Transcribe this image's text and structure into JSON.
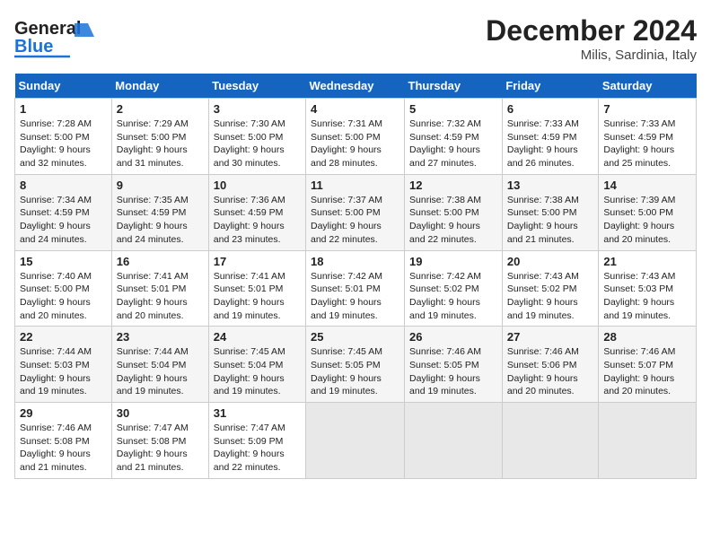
{
  "header": {
    "logo_general": "General",
    "logo_blue": "Blue",
    "month_title": "December 2024",
    "location": "Milis, Sardinia, Italy"
  },
  "weekdays": [
    "Sunday",
    "Monday",
    "Tuesday",
    "Wednesday",
    "Thursday",
    "Friday",
    "Saturday"
  ],
  "weeks": [
    [
      {
        "day": "1",
        "sunrise": "Sunrise: 7:28 AM",
        "sunset": "Sunset: 5:00 PM",
        "daylight": "Daylight: 9 hours and 32 minutes."
      },
      {
        "day": "2",
        "sunrise": "Sunrise: 7:29 AM",
        "sunset": "Sunset: 5:00 PM",
        "daylight": "Daylight: 9 hours and 31 minutes."
      },
      {
        "day": "3",
        "sunrise": "Sunrise: 7:30 AM",
        "sunset": "Sunset: 5:00 PM",
        "daylight": "Daylight: 9 hours and 30 minutes."
      },
      {
        "day": "4",
        "sunrise": "Sunrise: 7:31 AM",
        "sunset": "Sunset: 5:00 PM",
        "daylight": "Daylight: 9 hours and 28 minutes."
      },
      {
        "day": "5",
        "sunrise": "Sunrise: 7:32 AM",
        "sunset": "Sunset: 4:59 PM",
        "daylight": "Daylight: 9 hours and 27 minutes."
      },
      {
        "day": "6",
        "sunrise": "Sunrise: 7:33 AM",
        "sunset": "Sunset: 4:59 PM",
        "daylight": "Daylight: 9 hours and 26 minutes."
      },
      {
        "day": "7",
        "sunrise": "Sunrise: 7:33 AM",
        "sunset": "Sunset: 4:59 PM",
        "daylight": "Daylight: 9 hours and 25 minutes."
      }
    ],
    [
      {
        "day": "8",
        "sunrise": "Sunrise: 7:34 AM",
        "sunset": "Sunset: 4:59 PM",
        "daylight": "Daylight: 9 hours and 24 minutes."
      },
      {
        "day": "9",
        "sunrise": "Sunrise: 7:35 AM",
        "sunset": "Sunset: 4:59 PM",
        "daylight": "Daylight: 9 hours and 24 minutes."
      },
      {
        "day": "10",
        "sunrise": "Sunrise: 7:36 AM",
        "sunset": "Sunset: 4:59 PM",
        "daylight": "Daylight: 9 hours and 23 minutes."
      },
      {
        "day": "11",
        "sunrise": "Sunrise: 7:37 AM",
        "sunset": "Sunset: 5:00 PM",
        "daylight": "Daylight: 9 hours and 22 minutes."
      },
      {
        "day": "12",
        "sunrise": "Sunrise: 7:38 AM",
        "sunset": "Sunset: 5:00 PM",
        "daylight": "Daylight: 9 hours and 22 minutes."
      },
      {
        "day": "13",
        "sunrise": "Sunrise: 7:38 AM",
        "sunset": "Sunset: 5:00 PM",
        "daylight": "Daylight: 9 hours and 21 minutes."
      },
      {
        "day": "14",
        "sunrise": "Sunrise: 7:39 AM",
        "sunset": "Sunset: 5:00 PM",
        "daylight": "Daylight: 9 hours and 20 minutes."
      }
    ],
    [
      {
        "day": "15",
        "sunrise": "Sunrise: 7:40 AM",
        "sunset": "Sunset: 5:00 PM",
        "daylight": "Daylight: 9 hours and 20 minutes."
      },
      {
        "day": "16",
        "sunrise": "Sunrise: 7:41 AM",
        "sunset": "Sunset: 5:01 PM",
        "daylight": "Daylight: 9 hours and 20 minutes."
      },
      {
        "day": "17",
        "sunrise": "Sunrise: 7:41 AM",
        "sunset": "Sunset: 5:01 PM",
        "daylight": "Daylight: 9 hours and 19 minutes."
      },
      {
        "day": "18",
        "sunrise": "Sunrise: 7:42 AM",
        "sunset": "Sunset: 5:01 PM",
        "daylight": "Daylight: 9 hours and 19 minutes."
      },
      {
        "day": "19",
        "sunrise": "Sunrise: 7:42 AM",
        "sunset": "Sunset: 5:02 PM",
        "daylight": "Daylight: 9 hours and 19 minutes."
      },
      {
        "day": "20",
        "sunrise": "Sunrise: 7:43 AM",
        "sunset": "Sunset: 5:02 PM",
        "daylight": "Daylight: 9 hours and 19 minutes."
      },
      {
        "day": "21",
        "sunrise": "Sunrise: 7:43 AM",
        "sunset": "Sunset: 5:03 PM",
        "daylight": "Daylight: 9 hours and 19 minutes."
      }
    ],
    [
      {
        "day": "22",
        "sunrise": "Sunrise: 7:44 AM",
        "sunset": "Sunset: 5:03 PM",
        "daylight": "Daylight: 9 hours and 19 minutes."
      },
      {
        "day": "23",
        "sunrise": "Sunrise: 7:44 AM",
        "sunset": "Sunset: 5:04 PM",
        "daylight": "Daylight: 9 hours and 19 minutes."
      },
      {
        "day": "24",
        "sunrise": "Sunrise: 7:45 AM",
        "sunset": "Sunset: 5:04 PM",
        "daylight": "Daylight: 9 hours and 19 minutes."
      },
      {
        "day": "25",
        "sunrise": "Sunrise: 7:45 AM",
        "sunset": "Sunset: 5:05 PM",
        "daylight": "Daylight: 9 hours and 19 minutes."
      },
      {
        "day": "26",
        "sunrise": "Sunrise: 7:46 AM",
        "sunset": "Sunset: 5:05 PM",
        "daylight": "Daylight: 9 hours and 19 minutes."
      },
      {
        "day": "27",
        "sunrise": "Sunrise: 7:46 AM",
        "sunset": "Sunset: 5:06 PM",
        "daylight": "Daylight: 9 hours and 20 minutes."
      },
      {
        "day": "28",
        "sunrise": "Sunrise: 7:46 AM",
        "sunset": "Sunset: 5:07 PM",
        "daylight": "Daylight: 9 hours and 20 minutes."
      }
    ],
    [
      {
        "day": "29",
        "sunrise": "Sunrise: 7:46 AM",
        "sunset": "Sunset: 5:08 PM",
        "daylight": "Daylight: 9 hours and 21 minutes."
      },
      {
        "day": "30",
        "sunrise": "Sunrise: 7:47 AM",
        "sunset": "Sunset: 5:08 PM",
        "daylight": "Daylight: 9 hours and 21 minutes."
      },
      {
        "day": "31",
        "sunrise": "Sunrise: 7:47 AM",
        "sunset": "Sunset: 5:09 PM",
        "daylight": "Daylight: 9 hours and 22 minutes."
      },
      null,
      null,
      null,
      null
    ]
  ]
}
